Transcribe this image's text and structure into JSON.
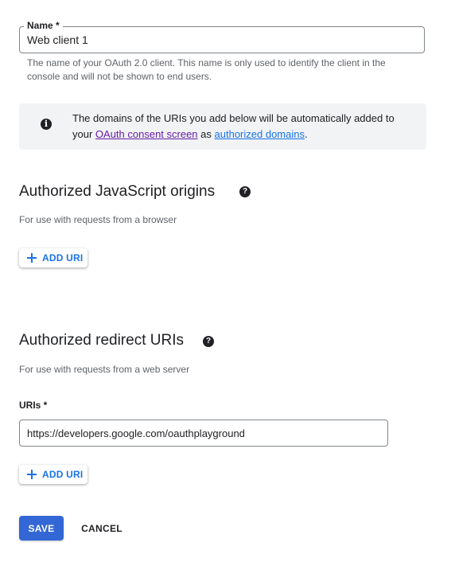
{
  "name_field": {
    "label": "Name *",
    "value": "Web client 1",
    "help": "The name of your OAuth 2.0 client. This name is only used to identify the client in the console and will not be shown to end users."
  },
  "info_banner": {
    "icon": "info-icon",
    "text_before": "The domains of the URIs you add below will be automatically added to your ",
    "link1": "OAuth consent screen",
    "text_middle": " as ",
    "link2": "authorized domains",
    "text_after": "."
  },
  "js_origins": {
    "title": "Authorized JavaScript origins",
    "help_icon": "help-icon",
    "description": "For use with requests from a browser",
    "add_button": "ADD URI"
  },
  "redirect_uris": {
    "title": "Authorized redirect URIs",
    "help_icon": "help-icon",
    "description": "For use with requests from a web server",
    "field_label": "URIs *",
    "field_value": "https://developers.google.com/oauthplayground",
    "add_button": "ADD URI"
  },
  "actions": {
    "save": "SAVE",
    "cancel": "CANCEL"
  },
  "colors": {
    "primary": "#1a73e8",
    "save_bg": "#3367d6",
    "visited_link": "#681da8",
    "banner_bg": "#f1f3f4"
  }
}
